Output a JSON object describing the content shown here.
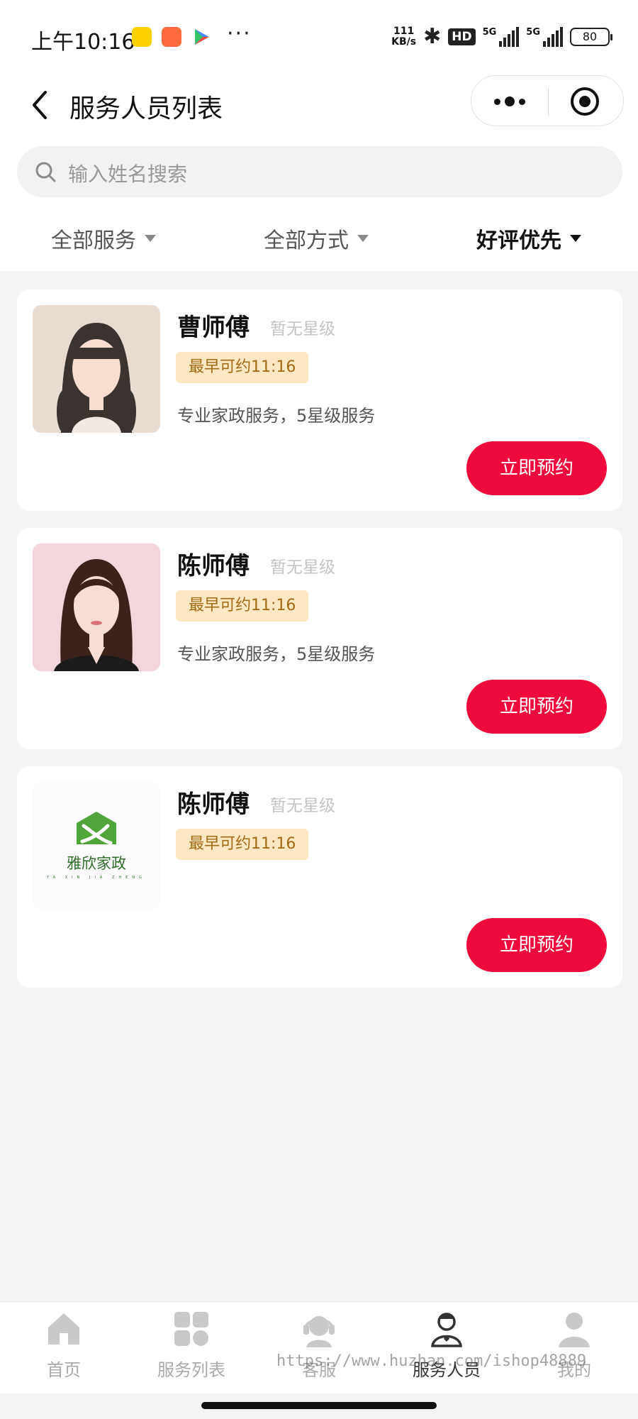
{
  "status_bar": {
    "time": "上午10:16",
    "more": "···",
    "net_speed_value": "111",
    "net_speed_unit": "KB/s",
    "hd_label": "HD",
    "network_1": "5G",
    "network_2": "5G",
    "battery": "80"
  },
  "nav": {
    "title": "服务人员列表"
  },
  "search": {
    "placeholder": "输入姓名搜索"
  },
  "filters": [
    {
      "label": "全部服务",
      "active": false
    },
    {
      "label": "全部方式",
      "active": false
    },
    {
      "label": "好评优先",
      "active": true
    }
  ],
  "workers": [
    {
      "name": "曹师傅",
      "rating": "暂无星级",
      "badge": "最早可约11:16",
      "desc": "专业家政服务，5星级服务",
      "button": "立即预约"
    },
    {
      "name": "陈师傅",
      "rating": "暂无星级",
      "badge": "最早可约11:16",
      "desc": "专业家政服务，5星级服务",
      "button": "立即预约"
    },
    {
      "name": "陈师傅",
      "rating": "暂无星级",
      "badge": "最早可约11:16",
      "desc": "",
      "button": "立即预约",
      "logo_text": "雅欣家政"
    }
  ],
  "tabbar": [
    {
      "label": "首页",
      "icon": "home-icon",
      "active": false
    },
    {
      "label": "服务列表",
      "icon": "grid-icon",
      "active": false
    },
    {
      "label": "客服",
      "icon": "headset-icon",
      "active": false
    },
    {
      "label": "服务人员",
      "icon": "worker-icon",
      "active": true
    },
    {
      "label": "我的",
      "icon": "user-icon",
      "active": false
    }
  ],
  "watermark": "https://www.huzhan.com/ishop48889",
  "colors": {
    "accent": "#f0093d",
    "badge_bg": "#fde8c3",
    "badge_text": "#a36a12",
    "page_bg": "#f4f4f6"
  }
}
